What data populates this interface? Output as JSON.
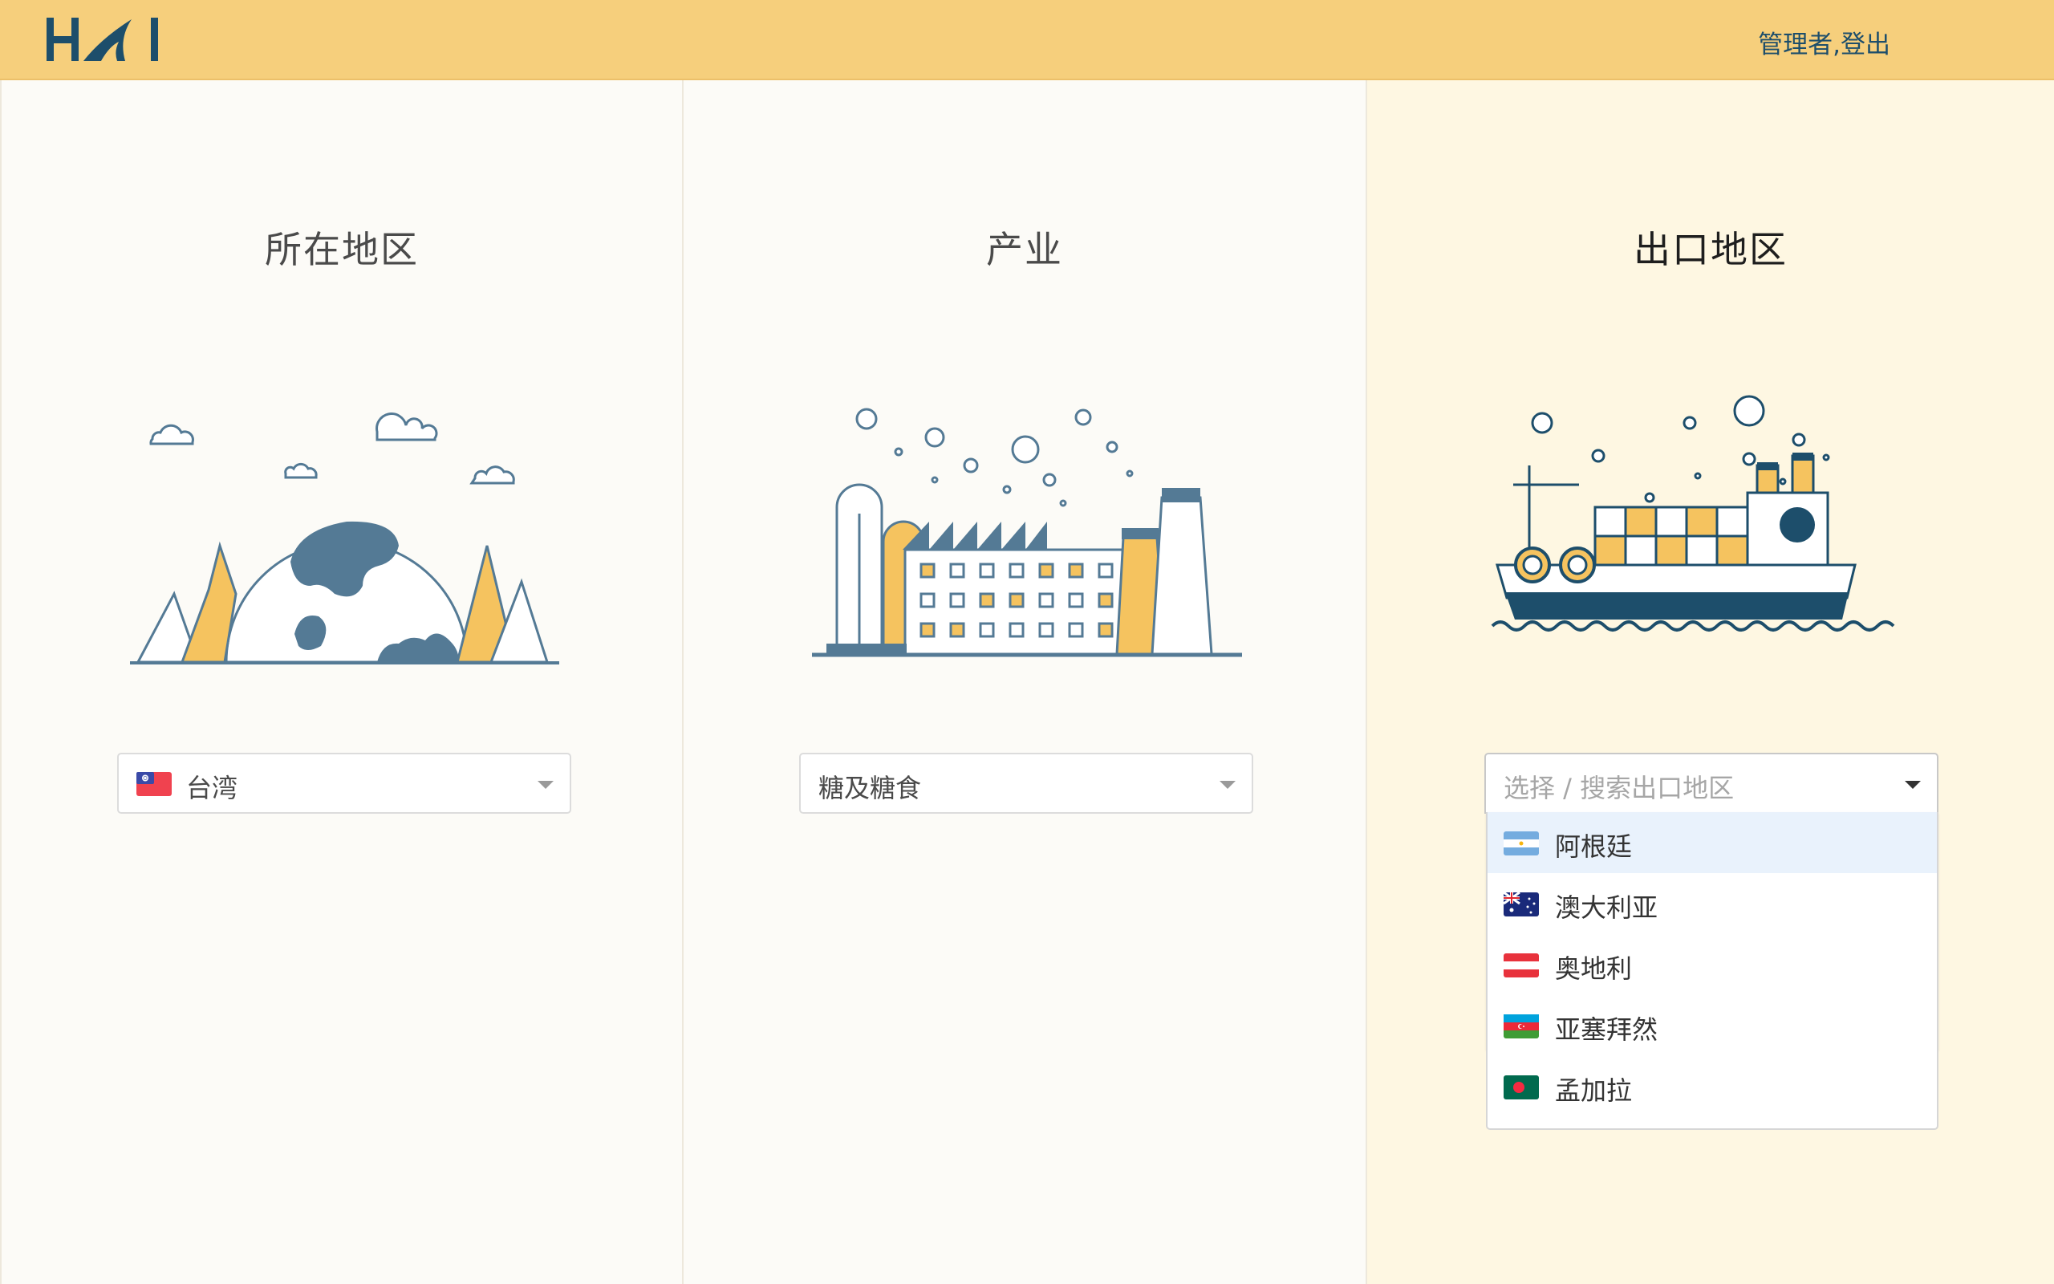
{
  "header": {
    "logo_label": "HAI",
    "admin_link": "管理者",
    "separator": ",",
    "logout_link": "登出",
    "background_color": "#f6cf7c"
  },
  "columns": [
    {
      "title": "所在地区",
      "illustration": "globe-with-trees-illustration",
      "select": {
        "value": "台湾",
        "flag": "taiwan-flag"
      }
    },
    {
      "title": "产业",
      "illustration": "factory-illustration",
      "select": {
        "value": "糖及糖食"
      }
    },
    {
      "title": "出口地区",
      "illustration": "cargo-ship-illustration",
      "select": {
        "placeholder": "选择 / 搜索出口地区",
        "open": true,
        "options": [
          {
            "label": "阿根廷",
            "flag": "argentina-flag",
            "highlighted": true
          },
          {
            "label": "澳大利亚",
            "flag": "australia-flag"
          },
          {
            "label": "奥地利",
            "flag": "austria-flag"
          },
          {
            "label": "亚塞拜然",
            "flag": "azerbaijan-flag"
          },
          {
            "label": "孟加拉",
            "flag": "bangladesh-flag"
          }
        ]
      }
    }
  ],
  "colors": {
    "accent_dark": "#1d4e6b",
    "illustration_blue": "#547a95",
    "illustration_yellow": "#f5c35f",
    "highlight_row": "#e9f2fc"
  }
}
